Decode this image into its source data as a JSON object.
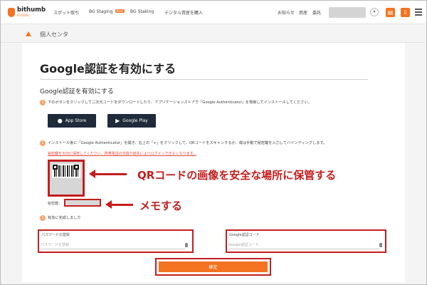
{
  "header": {
    "logo_text": "bithumb",
    "logo_sub": "GLOBAL",
    "nav": [
      "スポット取引",
      "BG Staging",
      "BG Staking",
      "デジタル資産を購入"
    ],
    "nav_badge": "NEW",
    "right_links": [
      "お知らせ",
      "資産",
      "委託"
    ],
    "icons": [
      "chevron-down-icon",
      "document-icon",
      "download-icon",
      "menu-icon"
    ]
  },
  "breadcrumb": {
    "label": "個人センタ"
  },
  "page": {
    "title": "Google認証を有効にする",
    "section_title": "Google認証を有効にする",
    "step1_num": "1",
    "step1_text": "下のボタンをクリックして二次元コードをダウンロードしたり、アプリケーションストアで「Google Authenticator」を検索してインストールしてください。",
    "app_store_label": "App Store",
    "google_play_label": "Google Play",
    "step2_num": "2",
    "step2_text": "インストール後に「Google Authenticator」を開き、右上の「+」をクリックして、QRコードをスキャンするか、或は手動で秘密鍵を入力してバインディングします。",
    "warning_text": "秘密鍵を大切に保管してください、携帯電話の交換や紛失によりログインできなくなります。",
    "secret_label": "秘密鍵：",
    "step3_num": "3",
    "step3_text": "有効に完成しました",
    "password_label": "パスワードの登録",
    "password_placeholder": "パスワードを登録",
    "google_code_label": "Google認証コード",
    "google_code_placeholder": "Google認証コード",
    "confirm_label": "確定"
  },
  "annotations": {
    "qr_note": "QRコードの画像を安全な場所に保管する",
    "memo_note": "メモする"
  },
  "colors": {
    "accent": "#f37321",
    "annotation": "#c41e1e",
    "store_button": "#1f2a3a"
  }
}
